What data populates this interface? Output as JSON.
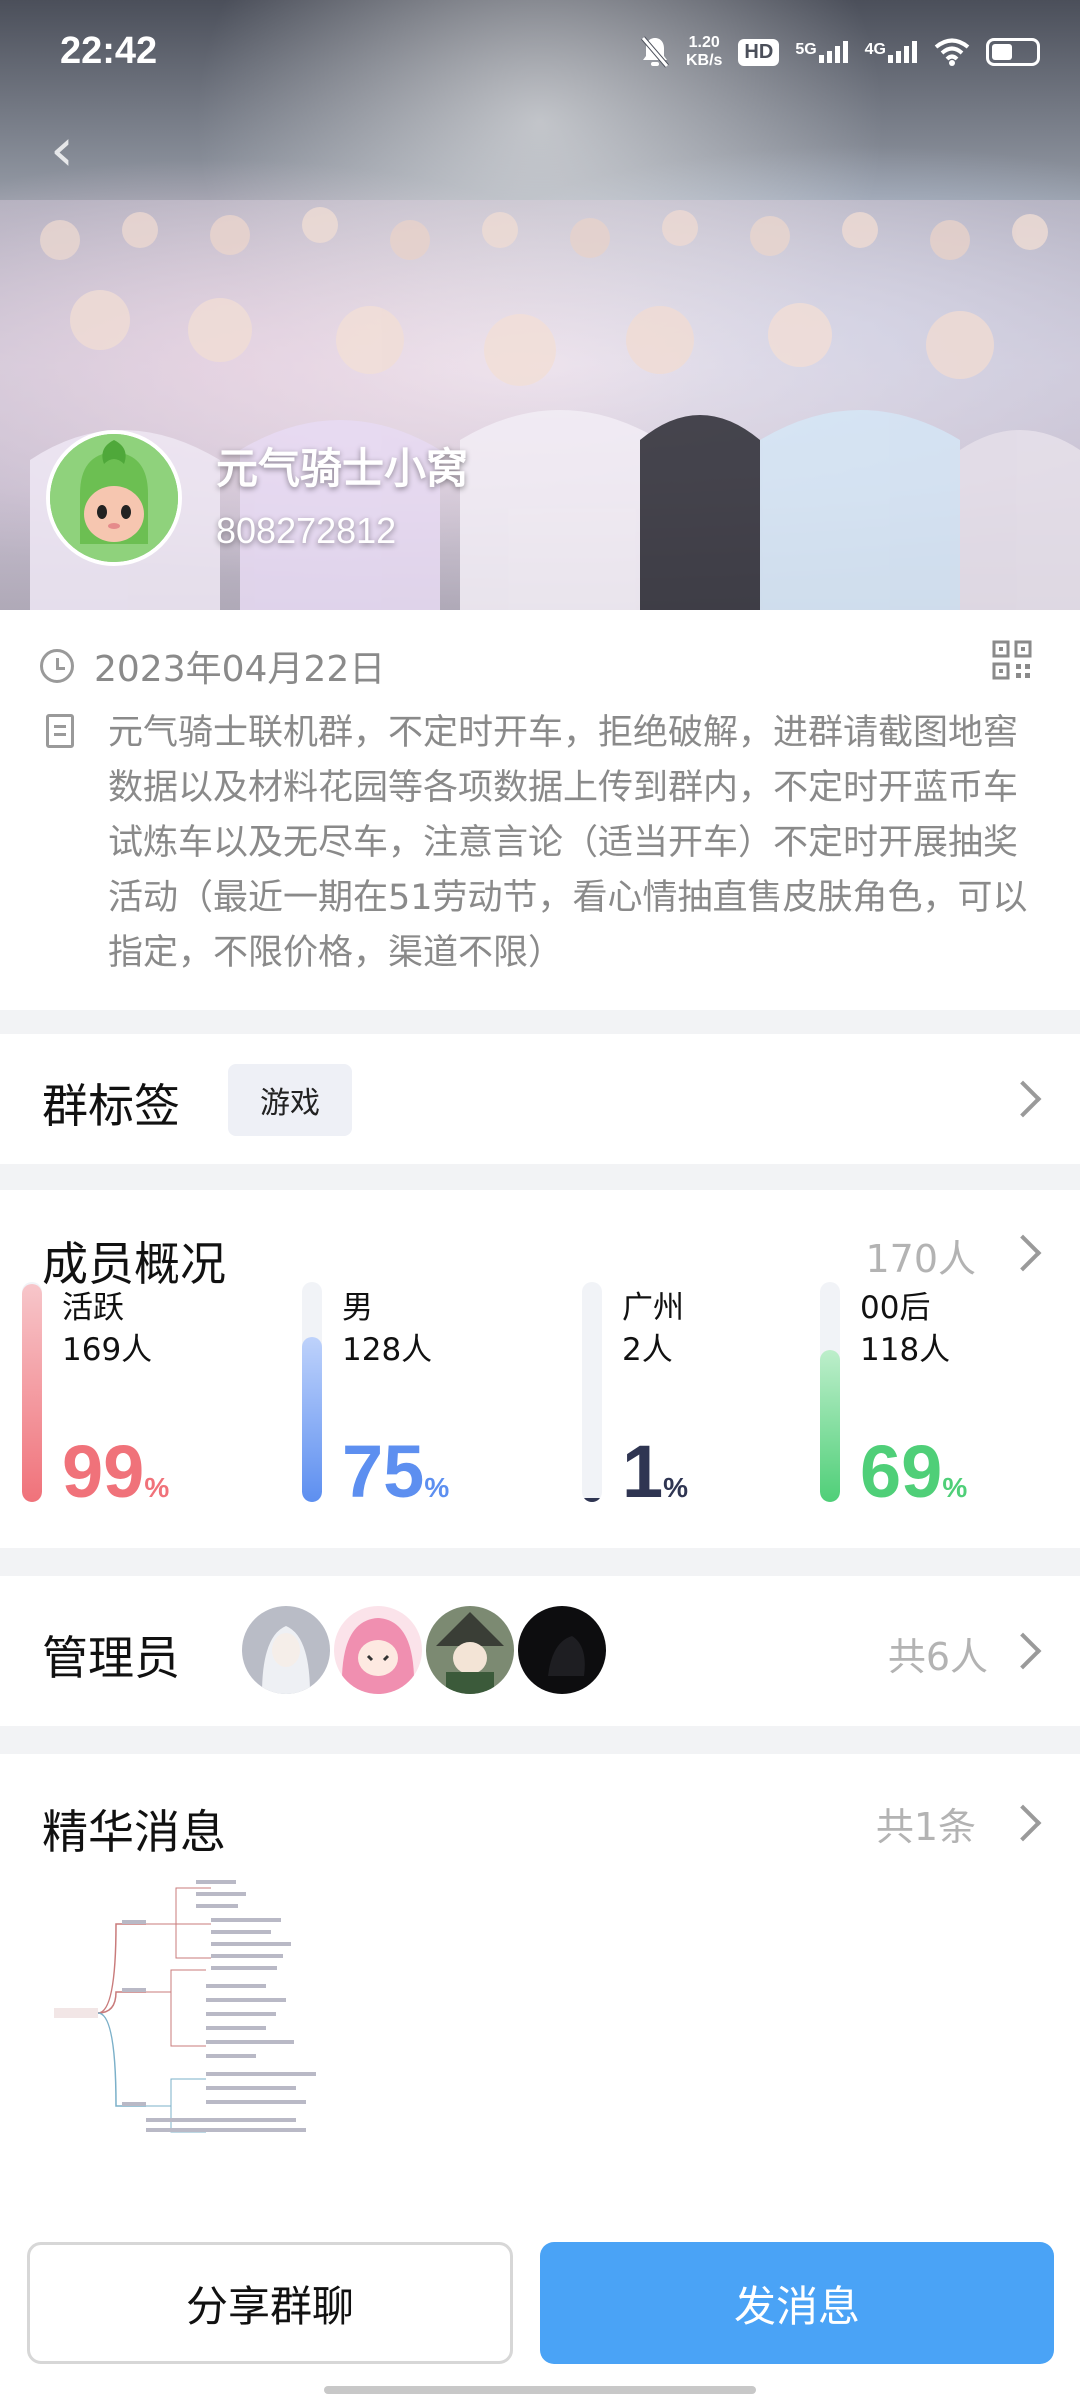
{
  "status_bar": {
    "time": "22:42",
    "net_speed_top": "1.20",
    "net_speed_unit": "KB/s",
    "hd_label": "HD",
    "sig1": "5G",
    "sig2": "4G"
  },
  "header": {
    "group_name": "元气骑士小窝",
    "group_id": "808272812"
  },
  "info": {
    "date": "2023年04月22日",
    "description": "元气骑士联机群，不定时开车，拒绝破解，进群请截图地窖数据以及材料花园等各项数据上传到群内，不定时开蓝币车试炼车以及无尽车，注意言论（适当开车）不定时开展抽奖活动（最近一期在51劳动节，看心情抽直售皮肤角色，可以指定，不限价格，渠道不限）"
  },
  "tags_section": {
    "title": "群标签",
    "tag": "游戏"
  },
  "members": {
    "title": "成员概况",
    "total": "170人",
    "stats": [
      {
        "label": "活跃",
        "count": "169人",
        "pct": "99",
        "fraction": 0.99,
        "color": "#f0727a",
        "bg": "#f7c6ca"
      },
      {
        "label": "男",
        "count": "128人",
        "pct": "75",
        "fraction": 0.75,
        "color": "#5d8ff0",
        "bg": "#bed2fb"
      },
      {
        "label": "广州",
        "count": "2人",
        "pct": "1",
        "fraction": 0.01,
        "color": "#2f3552",
        "bg": "#2f3552"
      },
      {
        "label": "00后",
        "count": "118人",
        "pct": "69",
        "fraction": 0.69,
        "color": "#4fcf78",
        "bg": "#bdeecb"
      }
    ],
    "pct_unit": "%"
  },
  "admins": {
    "title": "管理员",
    "count": "共6人"
  },
  "essence": {
    "title": "精华消息",
    "count": "共1条"
  },
  "actions": {
    "share": "分享群聊",
    "send": "发消息"
  }
}
